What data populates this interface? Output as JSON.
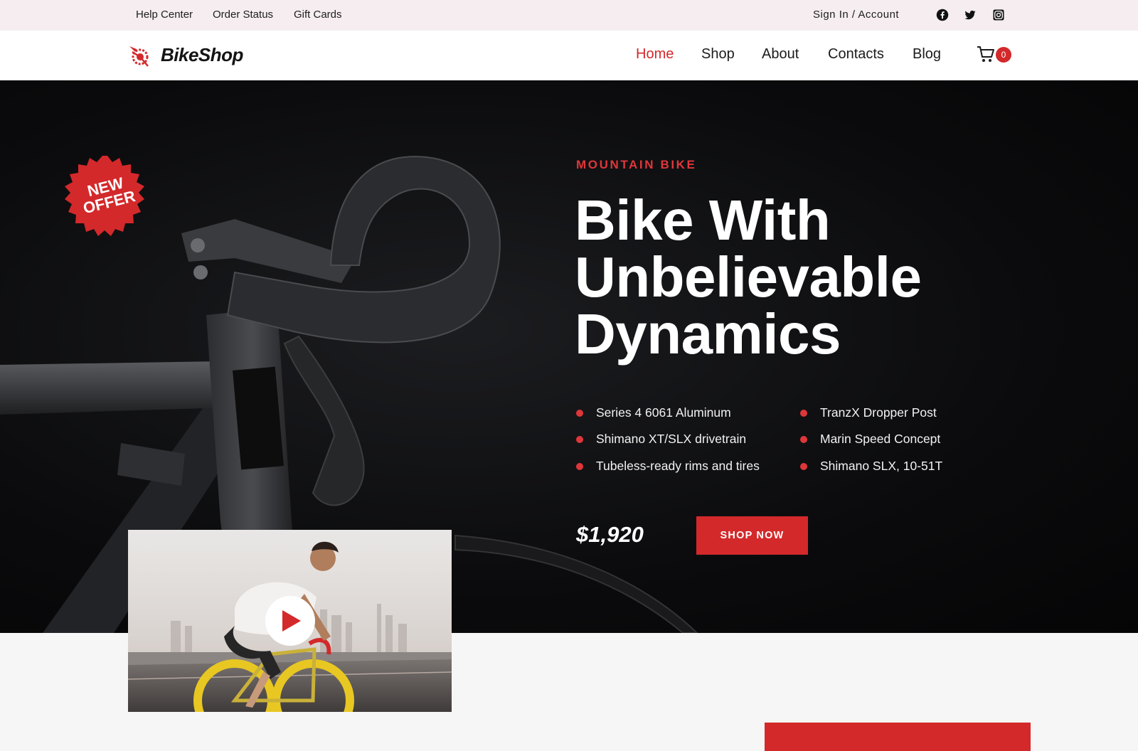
{
  "topbar": {
    "links": [
      "Help Center",
      "Order Status",
      "Gift Cards"
    ],
    "account": "Sign In / Account",
    "social_icons": [
      "facebook-icon",
      "twitter-icon",
      "instagram-icon"
    ]
  },
  "nav": {
    "brand": "BikeShop",
    "items": [
      {
        "label": "Home",
        "active": true
      },
      {
        "label": "Shop",
        "active": false
      },
      {
        "label": "About",
        "active": false
      },
      {
        "label": "Contacts",
        "active": false
      },
      {
        "label": "Blog",
        "active": false
      }
    ],
    "cart_count": "0"
  },
  "hero": {
    "badge": [
      "NEW",
      "OFFER"
    ],
    "eyebrow": "MOUNTAIN BIKE",
    "title_lines": [
      "Bike With",
      "Unbelievable",
      "Dynamics"
    ],
    "features_left": [
      "Series 4 6061 Aluminum",
      "Shimano XT/SLX drivetrain",
      "Tubeless-ready rims and tires"
    ],
    "features_right": [
      "TranzX Dropper Post",
      "Marin Speed Concept",
      "Shimano SLX, 10-51T"
    ],
    "price": "$1,920",
    "cta": "SHOP NOW"
  },
  "colors": {
    "accent": "#d3292b",
    "hero_bg": "#0b0b0d",
    "topbar_bg": "#f5edf0"
  }
}
